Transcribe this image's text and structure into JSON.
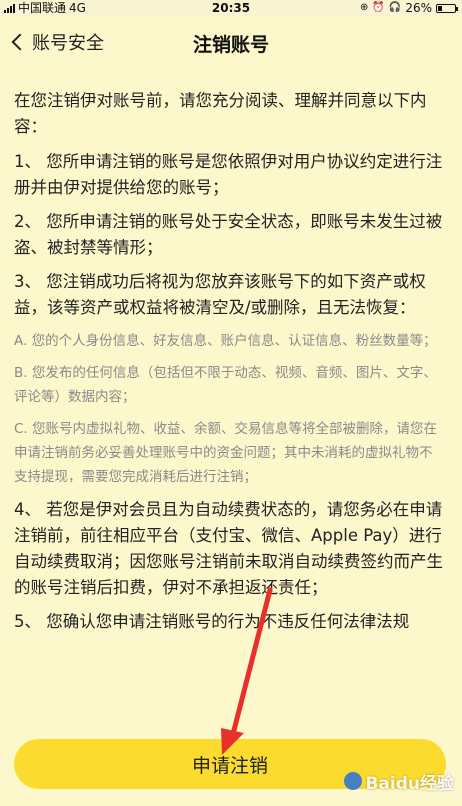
{
  "status_bar": {
    "carrier": "中国联通",
    "network": "4G",
    "time": "20:35",
    "battery": "26%",
    "battery_level": 0.26
  },
  "nav": {
    "back_label": "账号安全",
    "title": "注销账号"
  },
  "content": {
    "intro": "在您注销伊对账号前，请您充分阅读、理解并同意以下内容：",
    "clauses": [
      "1、 您所申请注销的账号是您依照伊对用户协议约定进行注册并由伊对提供给您的账号；",
      "2、 您所申请注销的账号处于安全状态，即账号未发生过被盗、被封禁等情形；",
      "3、 您注销成功后将视为您放弃该账号下的如下资产或权益，该等资产或权益将被清空及/或删除，且无法恢复："
    ],
    "sub_items": [
      "A. 您的个人身份信息、好友信息、账户信息、认证信息、粉丝数量等；",
      "B. 您发布的任何信息（包括但不限于动态、视频、音频、图片、文字、评论等）数据内容；",
      "C. 您账号内虚拟礼物、收益、余额、交易信息等将全部被删除，请您在申请注销前务必妥善处理账号中的资金问题；其中未消耗的虚拟礼物不支持提现，需要您完成消耗后进行注销；"
    ],
    "clause4": "4、 若您是伊对会员且为自动续费状态的，请您务必在申请注销前，前往相应平台（支付宝、微信、Apple Pay）进行自动续费取消；因您账号注销前未取消自动续费签约而产生的账号注销后扣费，伊对不承担返还责任；",
    "clause5": "5、 您确认您申请注销账号的行为不违反任何法律法规"
  },
  "bottom": {
    "apply_label": "申请注销"
  },
  "watermark": {
    "text": "Baidu经验"
  },
  "colors": {
    "background": "#fdf7cc",
    "button": "#fbdb2e",
    "arrow": "#e8302a",
    "sub_text": "#8a8a8a"
  }
}
